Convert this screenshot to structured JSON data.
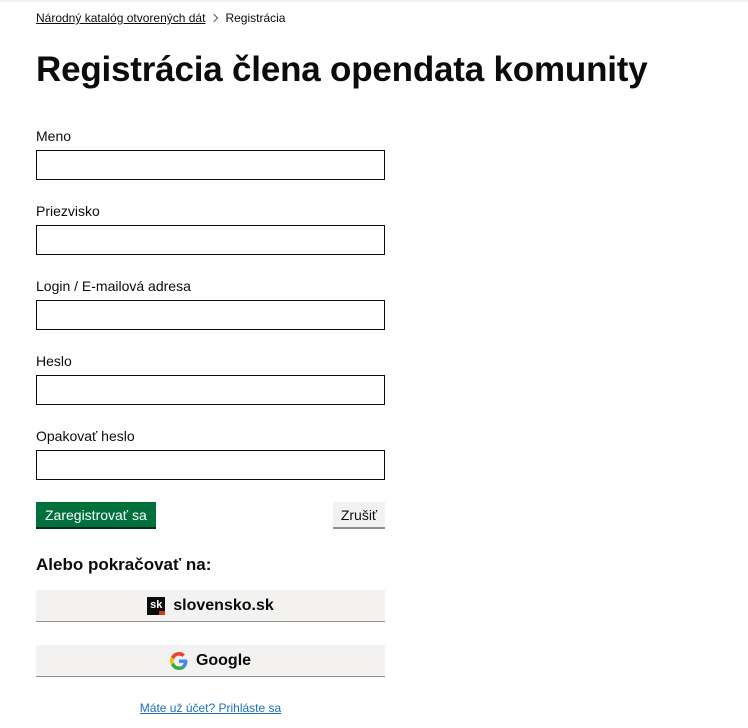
{
  "breadcrumb": {
    "home_label": "Národný katalóg otvorených dát",
    "current_label": "Registrácia"
  },
  "page": {
    "title": "Registrácia člena opendata komunity"
  },
  "form": {
    "first_name": {
      "label": "Meno",
      "value": ""
    },
    "last_name": {
      "label": "Priezvisko",
      "value": ""
    },
    "login": {
      "label": "Login / E-mailová adresa",
      "value": ""
    },
    "password": {
      "label": "Heslo",
      "value": ""
    },
    "password_repeat": {
      "label": "Opakovať heslo",
      "value": ""
    },
    "submit_label": "Zaregistrovať sa",
    "cancel_label": "Zrušiť"
  },
  "alternatives": {
    "heading": "Alebo pokračovať na:",
    "providers": [
      {
        "label": "slovensko.sk",
        "icon": "slovensko-sk-logo-icon",
        "logo_text": "sk"
      },
      {
        "label": "Google",
        "icon": "google-logo-icon"
      }
    ]
  },
  "login_link": {
    "label": "Máte už účet? Prihláste sa"
  },
  "colors": {
    "primary_button": "#00703c",
    "link": "#1d70b8",
    "secondary_button_bg": "#f3f2f1",
    "text": "#0b0c0c",
    "accent_red": "#d4351c"
  }
}
